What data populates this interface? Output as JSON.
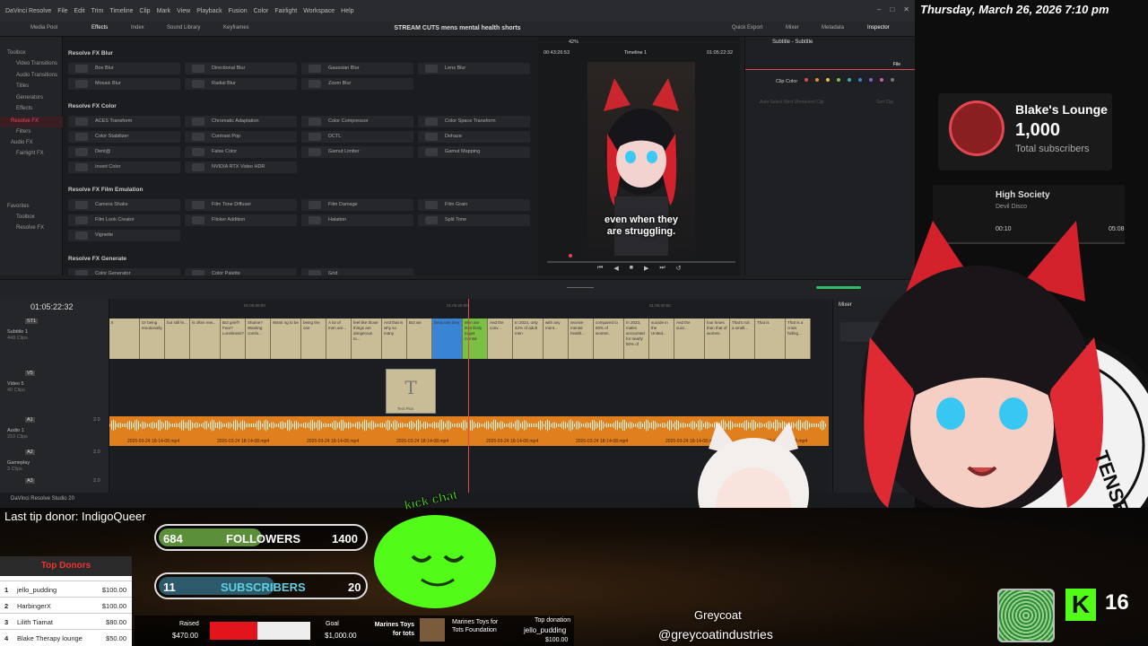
{
  "app": {
    "menus": [
      "DaVinci Resolve",
      "File",
      "Edit",
      "Trim",
      "Timeline",
      "Clip",
      "Mark",
      "View",
      "Playback",
      "Fusion",
      "Color",
      "Fairlight",
      "Workspace",
      "Help"
    ],
    "toolbar_left": [
      "Media Pool",
      "Effects",
      "Index",
      "Sound Library",
      "Keyframes"
    ],
    "project_title": "STREAM CUTS mens mental health shorts",
    "toolbar_right": [
      "Quick Export",
      "Mixer",
      "Metadata",
      "Inspector"
    ],
    "sidebar": [
      "Toolbox",
      "Video Transitions",
      "Audio Transitions",
      "Titles",
      "Generators",
      "Effects",
      "Resolve FX",
      "Filters",
      "Audio FX",
      "Fairlight FX",
      "Favorites",
      "Toolbox",
      "Resolve FX"
    ],
    "fx_sections": [
      {
        "title": "Resolve FX Blur",
        "items": [
          "Box Blur",
          "Directional Blur",
          "Gaussian Blur",
          "Lens Blur",
          "Mosaic Blur",
          "Radial Blur",
          "Zoom Blur"
        ]
      },
      {
        "title": "Resolve FX Color",
        "items": [
          "ACES Transform",
          "Chromatic Adaptation",
          "Color Compressor",
          "Color Space Transform",
          "Color Stabilizer",
          "Contrast Pop",
          "DCTL",
          "Dehaze",
          "Dent@",
          "False Color",
          "Gamut Limiter",
          "Gamut Mapping",
          "Invert Color",
          "NVIDIA RTX Video HDR"
        ]
      },
      {
        "title": "Resolve FX Film Emulation",
        "items": [
          "Camera Shake",
          "Film Tone Diffuser",
          "Film Damage",
          "Film Grain",
          "Film Look Creator",
          "Flicker Addition",
          "Halation",
          "Split Tone",
          "Vignette"
        ]
      },
      {
        "title": "Resolve FX Generate",
        "items": [
          "Color Generator",
          "Color Palette",
          "Grid"
        ]
      }
    ],
    "viewer": {
      "zoom": "42%",
      "timecode_left": "00:43:26:53",
      "timeline": "Timeline 1",
      "timecode_right": "01:05:22:32",
      "subtitle_line1": "even when they",
      "subtitle_line2": "are struggling."
    },
    "inspector": {
      "title": "Subtitle - Subtitle",
      "tab": "File",
      "clip_color": "Clip Color",
      "hint": "Auto Select Next Unmarked Clip",
      "hint2": "Sort Clip"
    },
    "timeline": {
      "timecode": "01:05:22:32",
      "ruler": [
        "01:05:00:00",
        "01:05:20:00",
        "01:05:40:00"
      ],
      "tracks": [
        {
          "id": "ST1",
          "name": "Subtitle 1",
          "clips": "448 Clips"
        },
        {
          "id": "V5",
          "name": "Video 5",
          "clips": "40 Clips"
        },
        {
          "id": "A1",
          "name": "Audio 1",
          "clips": "310 Clips",
          "level": "2.0"
        },
        {
          "id": "A2",
          "name": "Gameplay",
          "clips": "3 Clips",
          "level": "2.0"
        },
        {
          "id": "A3",
          "name": "",
          "clips": "",
          "level": "2.0"
        }
      ],
      "subtitle_clips": [
        "It",
        "Or being emotionally",
        "but still fe...",
        "is often rew...",
        "But grief? Fear? Loneliness?",
        "Shame? Wanting comfo...",
        "Wanti ng to be",
        "being the one",
        "A lot of men are...",
        "feel like those things are dangerous to...",
        "And that is why so many",
        "But we",
        "beca use they",
        "Men are less likely to get mental",
        "And the conv...",
        "In 2024, only 42% of adult men",
        "with any ment...",
        "receive mental health...",
        "compared to 60% of women.",
        "In 2023, males accounted for nearly 80% of",
        "suicide in the United...",
        "And the suici...",
        "four times than that of women.",
        "That's not a small...",
        "That is",
        "That is a crisis hiding..."
      ],
      "text_clip": "Text Plus",
      "audio_clip": "2026-03-24 18-14-08.mp4",
      "mixer": "Mixer"
    },
    "statusbar": "DaVinci Resolve Studio 20"
  },
  "overlay": {
    "datetime": "Thursday, March 26, 2026 7:10 pm",
    "channel_name": "Blake's Lounge",
    "subscribers": "1,000",
    "subscribers_label": "Total subscribers",
    "song_title": "High Society",
    "song_artist": "Devil Disco",
    "song_elapsed": "00:10",
    "song_total": "05:08",
    "last_tip": "Last tip donor: IndigoQueer",
    "followers": {
      "current": "684",
      "label": "FOLLOWERS",
      "goal": "1400",
      "fraction": 0.49
    },
    "subs": {
      "current": "11",
      "label": "SUBSCRIBERS",
      "goal": "20",
      "fraction": 0.55
    },
    "kick_label": "kick chat",
    "top_donors_title": "Top Donors",
    "top_donors": [
      {
        "rank": "1",
        "name": "jello_pudding",
        "amount": "$100.00"
      },
      {
        "rank": "2",
        "name": "HarbingerX",
        "amount": "$100.00"
      },
      {
        "rank": "3",
        "name": "Lilith Tiamat",
        "amount": "$80.00"
      },
      {
        "rank": "4",
        "name": "Blake Therapy lounge",
        "amount": "$50.00"
      }
    ],
    "raised_label": "Raised",
    "raised": "$470.00",
    "goal_label": "Goal",
    "goal": "$1,000.00",
    "raised_fraction": 0.47,
    "charity": "Marines Toys for tots",
    "charity2": "Marines Toys for Tots Foundation",
    "top_donation_label": "Top donation",
    "top_donation_name": "jello_pudding",
    "top_donation_amount": "$100.00",
    "guest_name": "Greycoat",
    "guest_handle": "@greycoatindustries",
    "kick_badge": "16",
    "seal_text": "TENSEI"
  },
  "colors": {
    "accent": "#e4464f",
    "audio": "#e07f1e",
    "subtitle": "#c9bd98",
    "followers_fill": "#5c8f3a",
    "kick": "#53fc18"
  }
}
